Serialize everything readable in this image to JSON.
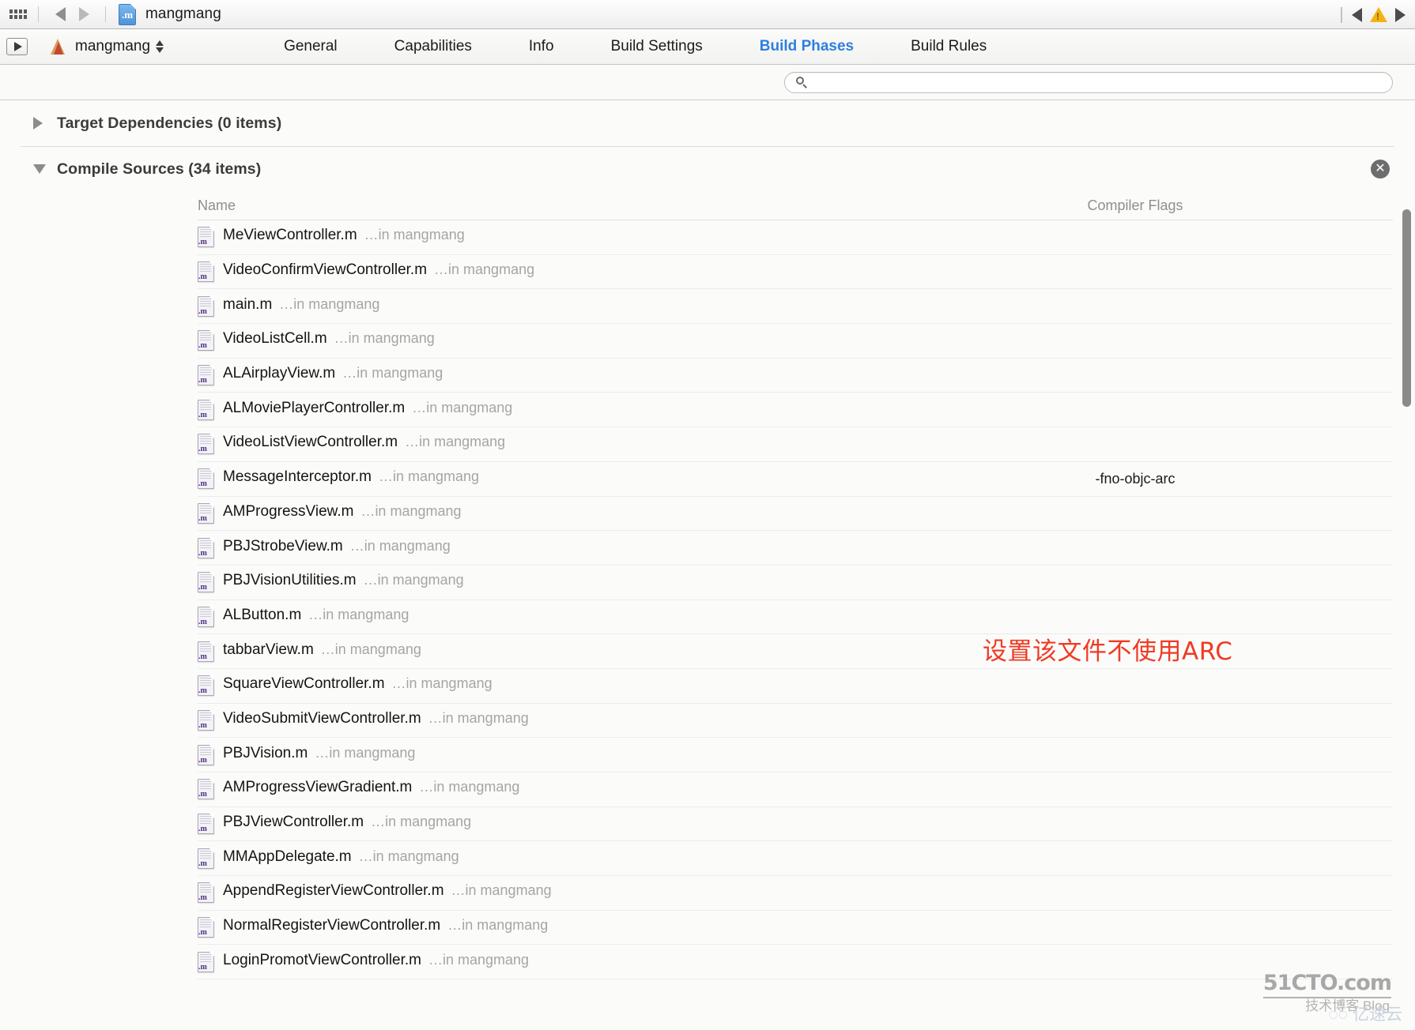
{
  "window": {
    "title": "mangmang",
    "grid_icon": "grid-icon",
    "back_icon": "back-arrow-icon",
    "forward_icon": "forward-arrow-icon",
    "file_icon_label": ".m",
    "issue_prev_icon": "previous-issue-icon",
    "warning_icon": "warning-triangle-icon",
    "issue_next_icon": "next-issue-icon"
  },
  "editor": {
    "scheme_button": "run-button",
    "target_name": "mangmang",
    "tabs": [
      {
        "label": "General",
        "active": false
      },
      {
        "label": "Capabilities",
        "active": false
      },
      {
        "label": "Info",
        "active": false
      },
      {
        "label": "Build Settings",
        "active": false
      },
      {
        "label": "Build Phases",
        "active": true
      },
      {
        "label": "Build Rules",
        "active": false
      }
    ]
  },
  "search": {
    "placeholder": "",
    "value": "",
    "icon": "search-icon"
  },
  "phases": [
    {
      "title": "Target Dependencies (0 items)",
      "expanded": false
    },
    {
      "title": "Compile Sources (34 items)",
      "expanded": true
    }
  ],
  "table": {
    "columns": {
      "name": "Name",
      "flags": "Compiler Flags"
    },
    "rows": [
      {
        "name": "MeViewController.m",
        "location": "…in mangmang",
        "flags": ""
      },
      {
        "name": "VideoConfirmViewController.m",
        "location": "…in mangmang",
        "flags": ""
      },
      {
        "name": "main.m",
        "location": "…in mangmang",
        "flags": ""
      },
      {
        "name": "VideoListCell.m",
        "location": "…in mangmang",
        "flags": ""
      },
      {
        "name": "ALAirplayView.m",
        "location": "…in mangmang",
        "flags": ""
      },
      {
        "name": "ALMoviePlayerController.m",
        "location": "…in mangmang",
        "flags": ""
      },
      {
        "name": "VideoListViewController.m",
        "location": "…in mangmang",
        "flags": ""
      },
      {
        "name": "MessageInterceptor.m",
        "location": "…in mangmang",
        "flags": "-fno-objc-arc"
      },
      {
        "name": "AMProgressView.m",
        "location": "…in mangmang",
        "flags": ""
      },
      {
        "name": "PBJStrobeView.m",
        "location": "…in mangmang",
        "flags": ""
      },
      {
        "name": "PBJVisionUtilities.m",
        "location": "…in mangmang",
        "flags": ""
      },
      {
        "name": "ALButton.m",
        "location": "…in mangmang",
        "flags": ""
      },
      {
        "name": "tabbarView.m",
        "location": "…in mangmang",
        "flags": ""
      },
      {
        "name": "SquareViewController.m",
        "location": "…in mangmang",
        "flags": ""
      },
      {
        "name": "VideoSubmitViewController.m",
        "location": "…in mangmang",
        "flags": ""
      },
      {
        "name": "PBJVision.m",
        "location": "…in mangmang",
        "flags": ""
      },
      {
        "name": "AMProgressViewGradient.m",
        "location": "…in mangmang",
        "flags": ""
      },
      {
        "name": "PBJViewController.m",
        "location": "…in mangmang",
        "flags": ""
      },
      {
        "name": "MMAppDelegate.m",
        "location": "…in mangmang",
        "flags": ""
      },
      {
        "name": "AppendRegisterViewController.m",
        "location": "…in mangmang",
        "flags": ""
      },
      {
        "name": "NormalRegisterViewController.m",
        "location": "…in mangmang",
        "flags": ""
      },
      {
        "name": "LoginPromotViewController.m",
        "location": "…in mangmang",
        "flags": ""
      }
    ],
    "file_ext_badge": ".m"
  },
  "annotation": {
    "text": "设置该文件不使用ARC",
    "color": "#ef3b23"
  },
  "remove_button_label": "✕",
  "watermark": {
    "primary": "51CTO.com",
    "secondary": "技术博客  Blog",
    "tertiary": "◌◌ 亿速云"
  },
  "colors": {
    "accent": "#2e7fe0",
    "annotation_red": "#ef3b23",
    "warning_yellow": "#f5b312"
  }
}
